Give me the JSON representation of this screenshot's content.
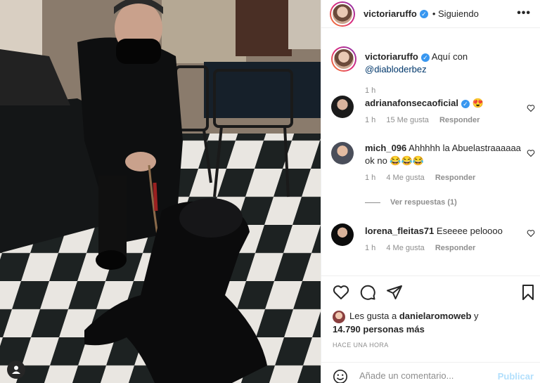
{
  "post": {
    "author": "victoriaruffo",
    "follow_status": "Siguiendo",
    "caption_text": "Aquí con",
    "caption_mention": "@diabloderbez",
    "caption_time": "1 h"
  },
  "comments": [
    {
      "user": "adrianafonsecaoficial",
      "verified": true,
      "text": "😍",
      "time": "1 h",
      "likes": "15 Me gusta",
      "reply": "Responder"
    },
    {
      "user": "mich_096",
      "verified": false,
      "text": "Ahhhhh la Abuelastraaaaaa ok no 😂😂😂",
      "time": "1 h",
      "likes": "4 Me gusta",
      "reply": "Responder"
    },
    {
      "user": "lorena_fleitas71",
      "verified": false,
      "text": "Eseeee peloooo",
      "time": "1 h",
      "likes": "4 Me gusta",
      "reply": "Responder"
    }
  ],
  "view_replies": "Ver respuestas (1)",
  "likes_text_prefix": "Les gusta a",
  "likes_user": "danielaromoweb",
  "likes_mid": "y",
  "likes_count": "14.790 personas más",
  "timestamp": "HACE UNA HORA",
  "composer": {
    "placeholder": "Añade un comentario...",
    "publish": "Publicar"
  },
  "icons": {
    "more": "more-options-icon",
    "heart": "heart-icon",
    "comment": "comment-icon",
    "share": "share-icon",
    "save": "bookmark-icon",
    "emoji": "emoji-icon",
    "user": "user-icon"
  },
  "colors": {
    "verified": "#3897f0",
    "link": "#00376b",
    "publish_disabled": "#b2dffc"
  }
}
